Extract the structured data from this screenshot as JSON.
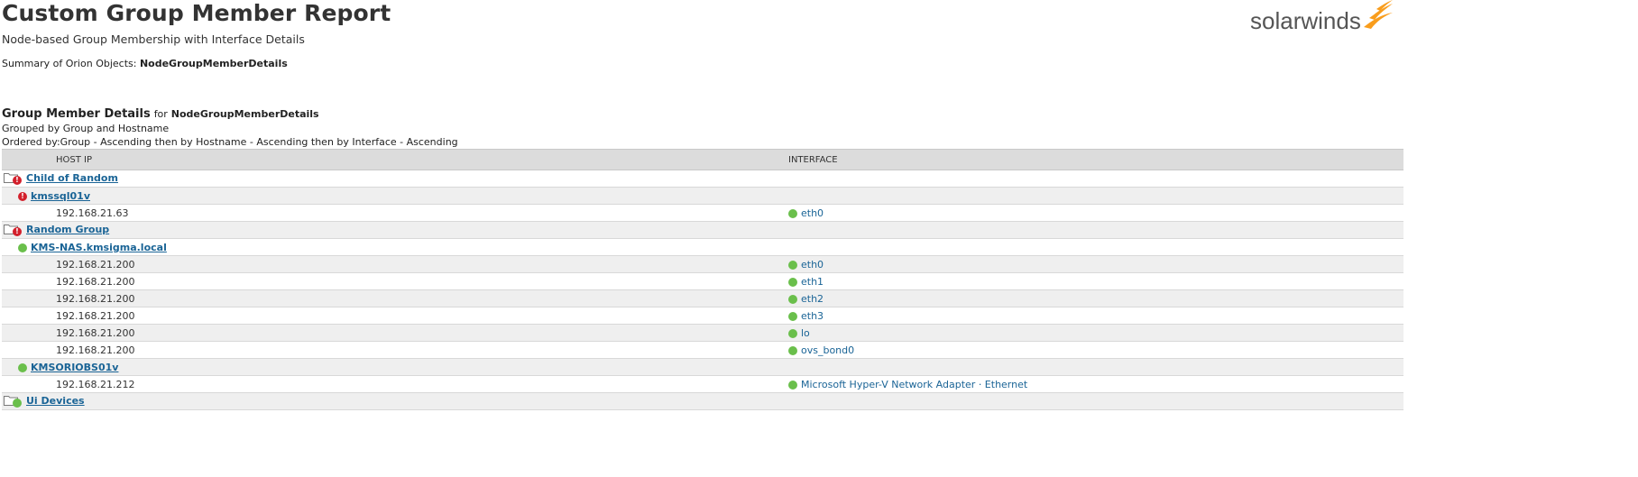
{
  "header": {
    "title": "Custom Group Member Report",
    "subtitle": "Node-based Group Membership with Interface Details",
    "summary_label": "Summary of Orion Objects:",
    "summary_value": "NodeGroupMemberDetails"
  },
  "brand": {
    "logo_text": "solarwinds",
    "logo_color": "#f99d1c"
  },
  "section": {
    "title": "Group Member Details",
    "for_label": "for",
    "target": "NodeGroupMemberDetails",
    "grouped_by": "Grouped by Group and Hostname",
    "ordered_by": "Ordered by:Group - Ascending then by Hostname - Ascending then by Interface - Ascending"
  },
  "columns": {
    "host_ip": "HOST IP",
    "interface": "INTERFACE"
  },
  "rows": [
    {
      "kind": "group",
      "name": "Child of Random",
      "status": "critical"
    },
    {
      "kind": "node",
      "name": "kmssql01v",
      "status": "critical"
    },
    {
      "kind": "data",
      "ip": "192.168.21.63",
      "interface": "eth0",
      "status": "up"
    },
    {
      "kind": "group",
      "name": "Random Group",
      "status": "critical"
    },
    {
      "kind": "node",
      "name": "KMS-NAS.kmsigma.local",
      "status": "up"
    },
    {
      "kind": "data",
      "ip": "192.168.21.200",
      "interface": "eth0",
      "status": "up"
    },
    {
      "kind": "data",
      "ip": "192.168.21.200",
      "interface": "eth1",
      "status": "up"
    },
    {
      "kind": "data",
      "ip": "192.168.21.200",
      "interface": "eth2",
      "status": "up"
    },
    {
      "kind": "data",
      "ip": "192.168.21.200",
      "interface": "eth3",
      "status": "up"
    },
    {
      "kind": "data",
      "ip": "192.168.21.200",
      "interface": "lo",
      "status": "up"
    },
    {
      "kind": "data",
      "ip": "192.168.21.200",
      "interface": "ovs_bond0",
      "status": "up"
    },
    {
      "kind": "node",
      "name": "KMSORIOBS01v",
      "status": "up"
    },
    {
      "kind": "data",
      "ip": "192.168.21.212",
      "interface": "Microsoft Hyper-V Network Adapter · Ethernet",
      "status": "up"
    },
    {
      "kind": "group",
      "name": "Ui Devices",
      "status": "up"
    }
  ],
  "colors": {
    "link": "#1a6496",
    "status_up": "#6abf4b",
    "status_critical": "#d3202c",
    "header_bg": "#dcdcdc",
    "row_alt_bg": "#efefef"
  }
}
